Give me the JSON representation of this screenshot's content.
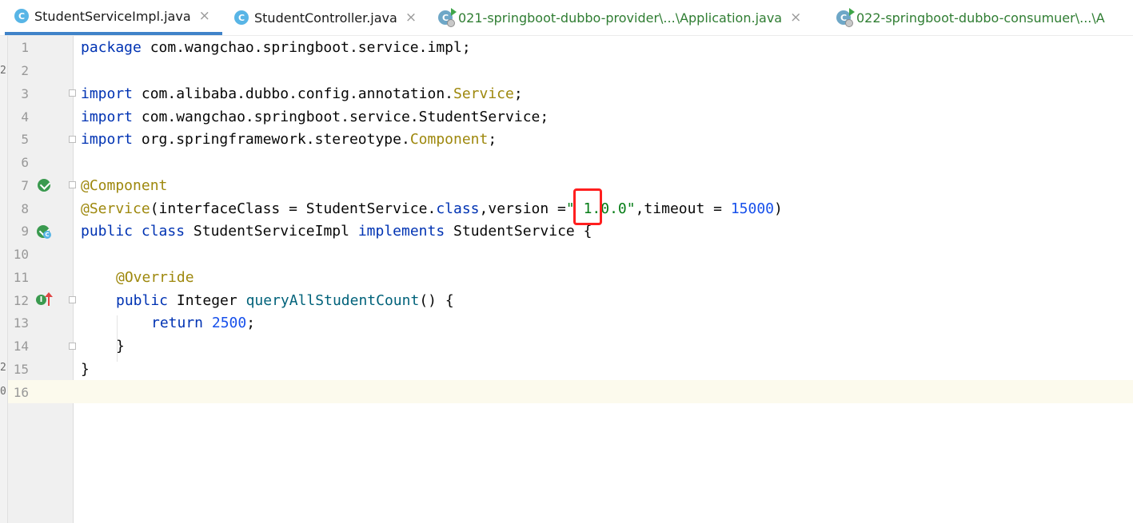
{
  "tabs": [
    {
      "label": "StudentServiceImpl.java",
      "icon": "class-icon",
      "active": true,
      "close": "×"
    },
    {
      "label": "StudentController.java",
      "icon": "class-icon",
      "active": false,
      "close": "×"
    },
    {
      "label": "021-springboot-dubbo-provider\\...\\Application.java",
      "icon": "runnable-class-icon",
      "active": false,
      "close": "×"
    },
    {
      "label": "022-springboot-dubbo-consumuer\\...\\A",
      "icon": "runnable-class-icon",
      "active": false,
      "close": ""
    }
  ],
  "icon_letters": {
    "class": "C",
    "implemented": "I"
  },
  "line_numbers": [
    "1",
    "2",
    "3",
    "4",
    "5",
    "6",
    "7",
    "8",
    "9",
    "10",
    "11",
    "12",
    "13",
    "14",
    "15",
    "16"
  ],
  "code": {
    "l1": {
      "kw": "package",
      "rest": " com.wangchao.springboot.service.impl;"
    },
    "l3": {
      "kw": "import",
      "a": " com.alibaba.dubbo.config.annotation.",
      "ann": "Service",
      "end": ";"
    },
    "l4": {
      "kw": "import",
      "rest": " com.wangchao.springboot.service.StudentService;"
    },
    "l5": {
      "kw": "import",
      "a": " org.springframework.stereotype.",
      "ann": "Component",
      "end": ";"
    },
    "l7": {
      "ann": "@Component"
    },
    "l8": {
      "ann": "@Service",
      "a": "(interfaceClass = StudentService.",
      "kw": "class",
      "b": ",version =",
      "str": "\" 1.0.0\"",
      "c": ",timeout = ",
      "num": "15000",
      "end": ")"
    },
    "l9": {
      "kw1": "public",
      "kw2": "class",
      "name": " StudentServiceImpl ",
      "kw3": "implements",
      "rest": " StudentService {"
    },
    "l11": {
      "ann": "@Override"
    },
    "l12": {
      "kw": "public",
      "type": " Integer ",
      "meth": "queryAllStudentCount",
      "rest": "() {"
    },
    "l13": {
      "kw": "return",
      "num": "2500",
      "end": ";"
    },
    "l14": {
      "rest": "}"
    },
    "l15": {
      "rest": "}"
    }
  },
  "left_edge_glyphs": [
    "2",
    "2",
    "0"
  ],
  "colors": {
    "keyword": "#0033b3",
    "annotation": "#9e880d",
    "string": "#067d17",
    "number": "#1750eb",
    "method": "#00627a",
    "highlight_box": "#ff1f1f",
    "active_tab_underline": "#4083c9"
  }
}
